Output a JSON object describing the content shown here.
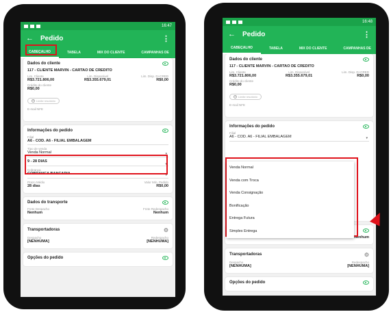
{
  "status": {
    "left_time": "16:47",
    "right_time": "16:48"
  },
  "appbar": {
    "title": "Pedido",
    "back_glyph": "←",
    "menu_glyph": "⋮"
  },
  "tabs": [
    "CABEÇALHO",
    "TABELA",
    "MIX DO CLIENTE",
    "CAMPANHAS DE"
  ],
  "cliente": {
    "title": "Dados do cliente",
    "name": "117 - CLIENTE MARVIN - CARTAO DE CREDITO",
    "lim_cliente_label": "Lim. Cliente",
    "lim_cliente": "R$3.721.806,00",
    "lim_disp_label": "Lim. Disponível",
    "lim_disp": "R$3.355.679,01",
    "lim_cred_label": "Lim. Disp. D+CRED",
    "lim_cred": "R$0,00",
    "credito_label": "Crédito do cliente",
    "credito": "R$0,00",
    "pill": "Limite resolvido",
    "email_label": "E-mail NFE"
  },
  "pedido": {
    "title": "Informações do pedido",
    "filial_label": "Filial",
    "filial_left": "A6 - COD. A6 - FILIAL EMBALAGEM",
    "filial_right": "A6 - COD. A6 - FILIAL EMBALAGEM",
    "tipo_label": "Tipo de venda",
    "tipo": "Venda Normal",
    "prazo": "9 - 28 DIAS",
    "cobranca_label": "Cobrança",
    "cobranca": "COBRANCA BANCARIA",
    "prazo_medio_label": "Prazo Médio",
    "prazo_medio": "28 dias",
    "valor_min_label": "Valor Mín. Pedido",
    "valor_min": "R$0,00"
  },
  "transporte": {
    "title": "Dados do transporte",
    "frete_desp_label": "Frete Despacho",
    "frete_desp": "Nenhum",
    "frete_redesp_label": "Frete Redespacho",
    "frete_redesp": "Nenhum"
  },
  "transportadoras": {
    "title": "Transportadoras",
    "despacho_label": "Despacho",
    "despacho": "[NENHUMA]",
    "redespacho_label": "Redespacho",
    "redespacho": "[NENHUMA]"
  },
  "opcoes": {
    "title": "Opções do pedido"
  },
  "dropdown": [
    "Venda Normal",
    "Venda com Troca",
    "Venda Consignação",
    "Bonificação",
    "Entrega Futura",
    "Simples Entrega"
  ],
  "colors": {
    "green": "#22b457",
    "highlight": "#e0121b"
  }
}
